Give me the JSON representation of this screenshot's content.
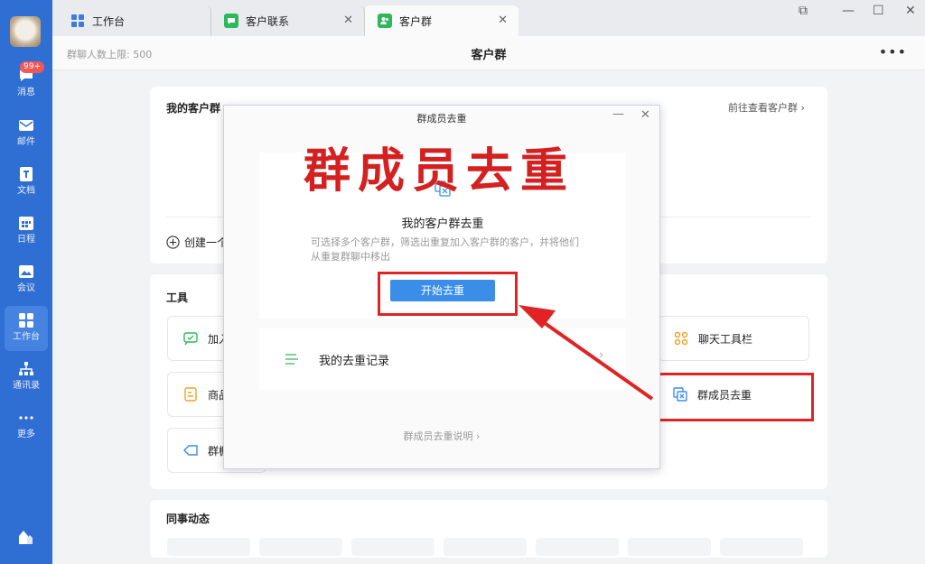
{
  "sidebar": {
    "badge": "99+",
    "items": [
      {
        "label": "消息",
        "icon": "chat-icon"
      },
      {
        "label": "邮件",
        "icon": "mail-icon"
      },
      {
        "label": "文档",
        "icon": "document-icon"
      },
      {
        "label": "日程",
        "icon": "calendar-icon"
      },
      {
        "label": "会议",
        "icon": "meeting-icon"
      },
      {
        "label": "工作台",
        "icon": "workbench-icon"
      },
      {
        "label": "通讯录",
        "icon": "contacts-icon"
      },
      {
        "label": "更多",
        "icon": "more-icon"
      }
    ]
  },
  "tabs": [
    {
      "label": "工作台",
      "icon": "workbench-icon"
    },
    {
      "label": "客户联系",
      "icon": "customer-contact-icon"
    },
    {
      "label": "客户群",
      "icon": "customer-group-icon"
    }
  ],
  "header": {
    "limit_text": "群聊人数上限: 500",
    "title": "客户群",
    "more": "•••"
  },
  "groups_card": {
    "title": "我的客户群",
    "view_link": "前往查看客户群 ›",
    "create_label": "创建一个"
  },
  "tools_card": {
    "title": "工具",
    "items": [
      {
        "label": "加入",
        "icon": "message-icon"
      },
      {
        "label": "商品",
        "icon": "product-icon"
      },
      {
        "label": "群橱",
        "icon": "tag-icon"
      },
      {
        "label": "聊天工具栏",
        "icon": "toolbar-icon"
      },
      {
        "label": "群成员去重",
        "icon": "dedupe-icon"
      }
    ]
  },
  "colleagues_card": {
    "title": "同事动态"
  },
  "modal": {
    "title": "群成员去重",
    "overlay_caption": "群成员去重",
    "heading": "我的客户群去重",
    "description": "可选择多个客户群，筛选出重复加入客户群的客户，并将他们从重复群聊中移出",
    "start_button": "开始去重",
    "records_label": "我的去重记录",
    "explain_link": "群成员去重说明 ›"
  },
  "colors": {
    "sidebar": "#2f6fd3",
    "accent": "#3b8ee8",
    "highlight": "#e02424"
  }
}
